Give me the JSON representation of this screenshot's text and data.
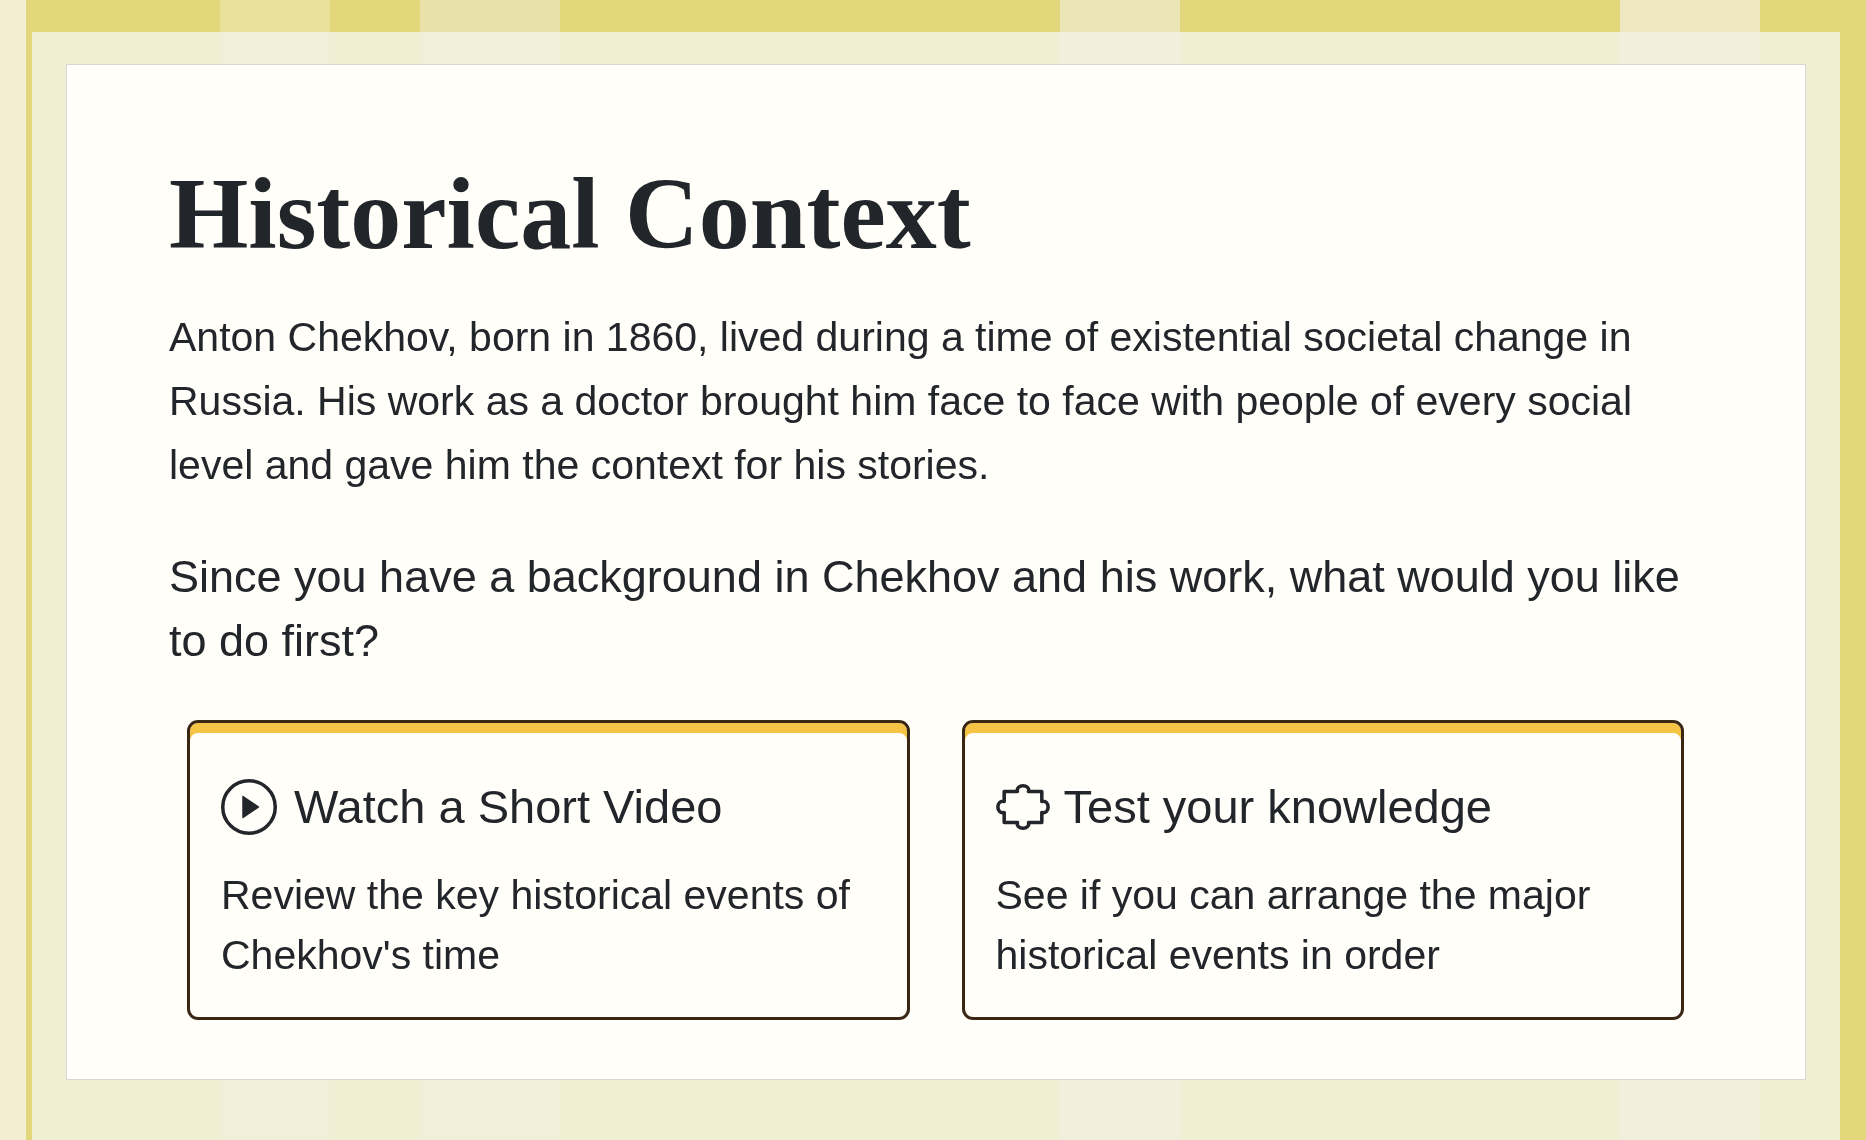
{
  "heading": "Historical Context",
  "intro": "Anton Chekhov, born in 1860, lived during a time of existential societal change in Russia. His work as a doctor brought him face to face with people of every social level and gave him the context for his stories.",
  "prompt": "Since you have a background in Chekhov and his work, what would you like to do first?",
  "options": [
    {
      "kind": "video",
      "title": "Watch a Short Video",
      "description": "Review the key historical events of Chekhov's time"
    },
    {
      "kind": "quiz",
      "title": "Test your knowledge",
      "description": "See if you can arrange the major historical events in order"
    }
  ]
}
